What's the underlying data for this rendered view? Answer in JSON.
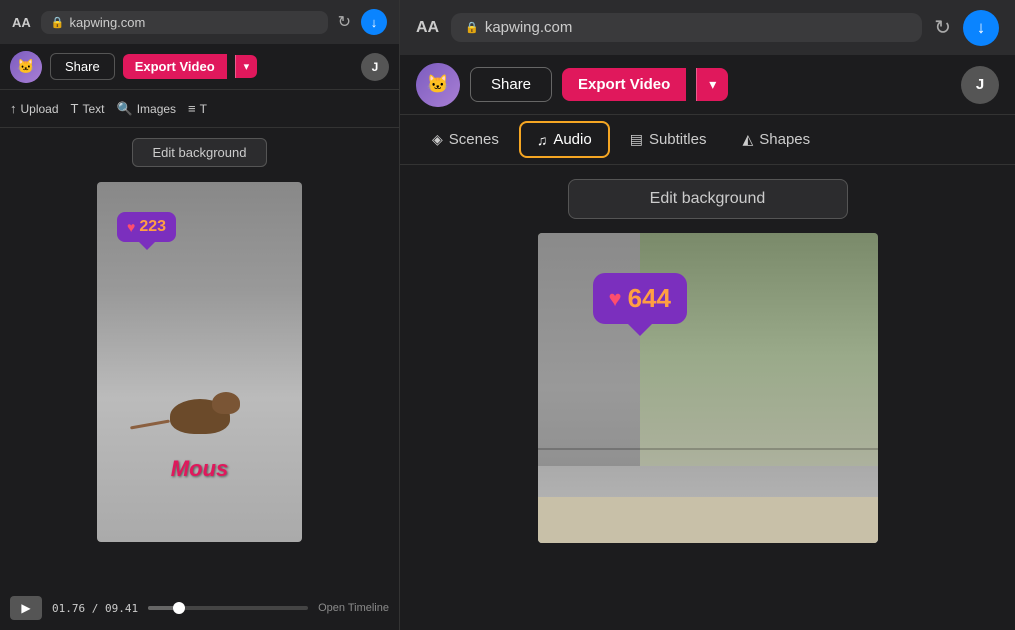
{
  "left": {
    "browser": {
      "font_size": "AA",
      "url": "kapwing.com",
      "lock_icon": "🔒",
      "refresh_icon": "↻",
      "download_icon": "↓"
    },
    "toolbar": {
      "share_label": "Share",
      "export_label": "Export Video",
      "dropdown_icon": "▾",
      "user_initial": "J"
    },
    "tools": {
      "upload_label": "Upload",
      "text_label": "Text",
      "images_label": "Images",
      "more_label": "T"
    },
    "edit_bg_label": "Edit background",
    "video": {
      "like_count": "223",
      "text_overlay": "Mous"
    },
    "timeline": {
      "current_time": "01.76",
      "total_time": "09.41",
      "open_label": "Open Timeline",
      "progress_pct": 19
    }
  },
  "right": {
    "browser": {
      "font_size": "AA",
      "url": "kapwing.com",
      "lock_icon": "🔒",
      "refresh_icon": "↻",
      "download_icon": "↓"
    },
    "toolbar": {
      "share_label": "Share",
      "export_label": "Export Video",
      "dropdown_icon": "▾",
      "user_initial": "J"
    },
    "nav": {
      "scenes_label": "Scenes",
      "scenes_icon": "◈",
      "audio_label": "Audio",
      "audio_icon": "♫",
      "subtitles_label": "Subtitles",
      "subtitles_icon": "▤",
      "shapes_label": "Shapes",
      "shapes_icon": "◭"
    },
    "edit_bg_label": "Edit background",
    "video": {
      "like_count": "644"
    }
  },
  "colors": {
    "accent_orange": "#f5a623",
    "export_red": "#e0185c",
    "like_purple": "#7b2fbe",
    "like_count_orange": "#ff9f43",
    "heart_red": "#ff4d6d",
    "browser_blue": "#0a84ff"
  }
}
